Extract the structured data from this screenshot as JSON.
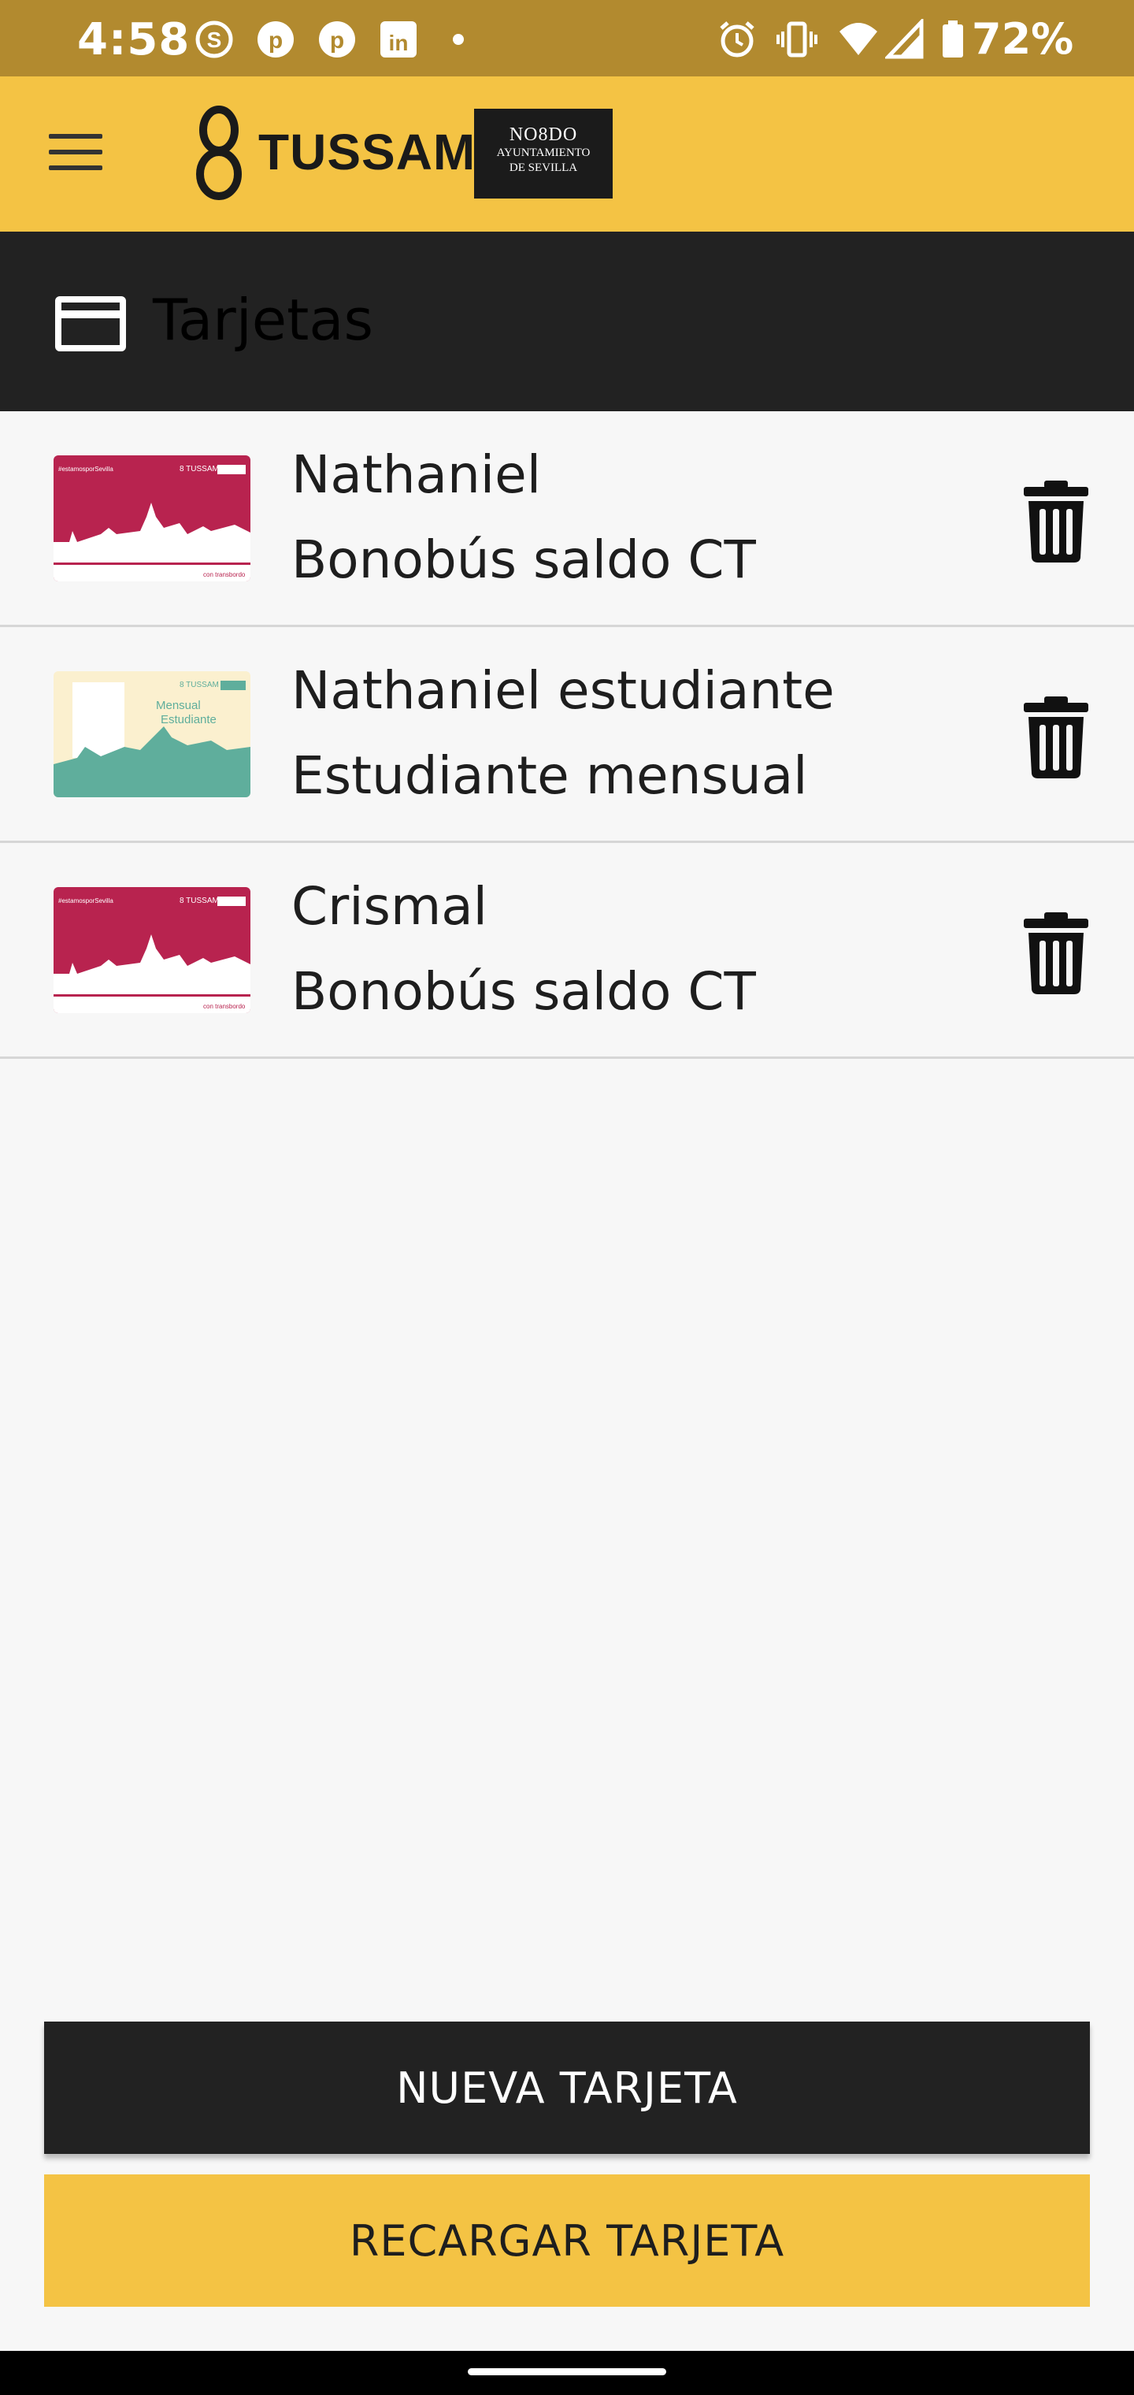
{
  "status_bar": {
    "time": "4:58",
    "battery": "72%",
    "left_icons": [
      "skype-icon",
      "pinterest-icon",
      "pinterest-icon",
      "linkedin-icon",
      "dot-icon"
    ],
    "right_icons": [
      "alarm-icon",
      "vibrate-icon",
      "wifi-icon",
      "signal-icon",
      "battery-icon"
    ]
  },
  "app_bar": {
    "menu_icon": "hamburger-menu-icon",
    "logo_text": "TUSSAM",
    "partner_logo": {
      "line1": "NO8DO",
      "line2": "AYUNTAMIENTO",
      "line3": "DE SEVILLA"
    },
    "colors": {
      "background": "#f4c344"
    }
  },
  "section": {
    "icon": "credit-card-icon",
    "title": "Tarjetas"
  },
  "cards": [
    {
      "name": "Nathaniel",
      "type": "Bonobús saldo CT",
      "thumbnail": "magenta-card",
      "action_icon": "trash-icon"
    },
    {
      "name": "Nathaniel estudiante",
      "type": "Estudiante mensual",
      "thumbnail": "student-card",
      "action_icon": "trash-icon"
    },
    {
      "name": "Crismal",
      "type": "Bonobús saldo CT",
      "thumbnail": "magenta-card",
      "action_icon": "trash-icon"
    }
  ],
  "card_art": {
    "magenta_card": {
      "hashtag": "#estamosporSevilla",
      "brand": "TUSSAM",
      "footer": "con transbordo",
      "color": "#b8234f"
    },
    "student_card": {
      "brand": "TUSSAM",
      "line1": "Mensual",
      "line2": "Estudiante",
      "color": "#5fae9c"
    }
  },
  "buttons": {
    "new_card": "NUEVA TARJETA",
    "recharge_card": "RECARGAR TARJETA"
  }
}
